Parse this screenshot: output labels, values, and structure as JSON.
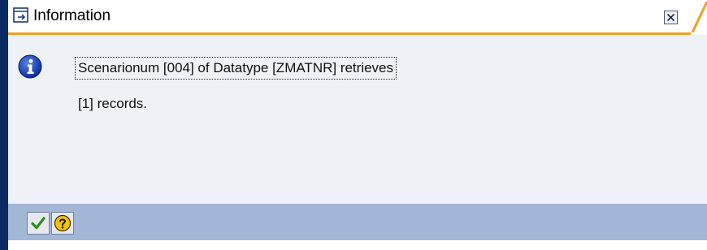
{
  "dialog": {
    "title": "Information",
    "title_icon": "dialog-window-icon",
    "close_icon": "close-icon",
    "message_icon": "info-icon",
    "message_line1": "Scenarionum [004] of Datatype [ZMATNR] retrieves",
    "message_line2": "[1] records.",
    "buttons": {
      "ok_icon": "checkmark-icon",
      "help_icon": "help-icon"
    },
    "colors": {
      "accent_orange": "#f0a020",
      "frame_navy": "#0a2a63",
      "footer_blue": "#a2b6d6",
      "info_blue": "#1a3fb0",
      "ok_green": "#2e8b1e",
      "help_yellow": "#f5c400"
    }
  }
}
